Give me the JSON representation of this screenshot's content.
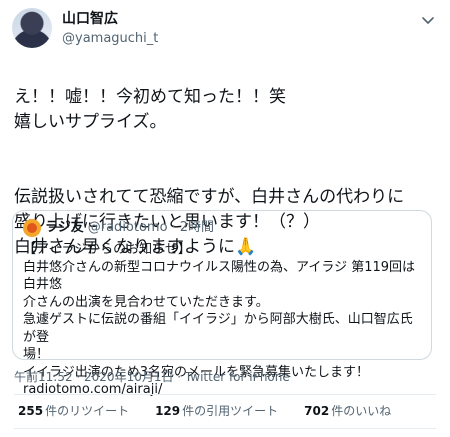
{
  "author": {
    "display_name": "山口智広",
    "handle": "@yamaguchi_t"
  },
  "tweet": {
    "paragraphs": [
      "え！！嘘！！今初めて知った！！笑\n嬉しいサプライズ。",
      "伝説扱いされてて恐縮ですが、白井さんの代わりに\n盛り上げに行きたいと思います！（？）\n白井さん早くなりますように🙏"
    ]
  },
  "quoted": {
    "name": "ラジ友",
    "handle": "@radiotomo",
    "dot": "·",
    "time": "2時間",
    "lines": [
      "【アイラジからのお知らせ】",
      "白井悠介さんの新型コロナウイルス陽性の為、アイラジ 第119回は白井悠",
      "介さんの出演を見合わせていただきます。",
      "急遽ゲストに伝説の番組「イイラジ」から阿部大樹氏、山口智広氏が登",
      "場！",
      "イイラジ出演のため3名宛のメールを緊急募集いたします！",
      "radiotomo.com/airaji/"
    ]
  },
  "meta": "午前11:52 · 2020年10月1日 · Twitter for iPhone",
  "stats": [
    {
      "count": "255",
      "label": "件のリツイート"
    },
    {
      "count": "129",
      "label": "件の引用ツイート"
    },
    {
      "count": "702",
      "label": "件のいいね"
    }
  ],
  "colors": {
    "text": "#0f1419",
    "secondary": "#536471",
    "border": "#cfd9de"
  },
  "icons": {
    "menu": "chevron-down-icon"
  }
}
